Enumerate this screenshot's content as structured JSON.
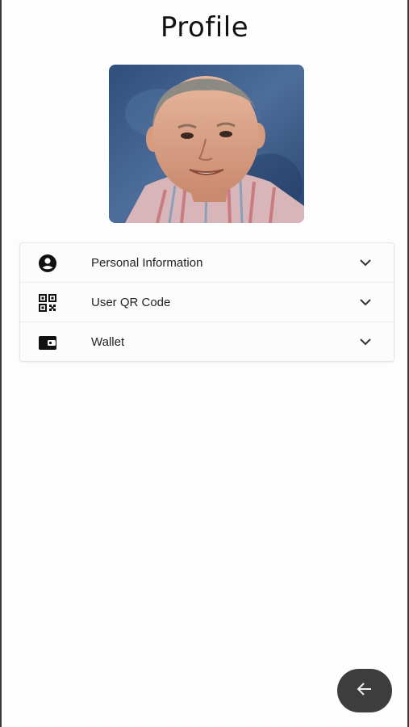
{
  "header": {
    "title": "Profile"
  },
  "profile": {
    "photo_icon": "avatar-photo"
  },
  "sections": [
    {
      "label": "Personal Information",
      "icon": "account-circle-icon"
    },
    {
      "label": "User QR Code",
      "icon": "qr-code-icon"
    },
    {
      "label": "Wallet",
      "icon": "wallet-icon"
    }
  ],
  "fab": {
    "icon": "arrow-back-icon"
  }
}
